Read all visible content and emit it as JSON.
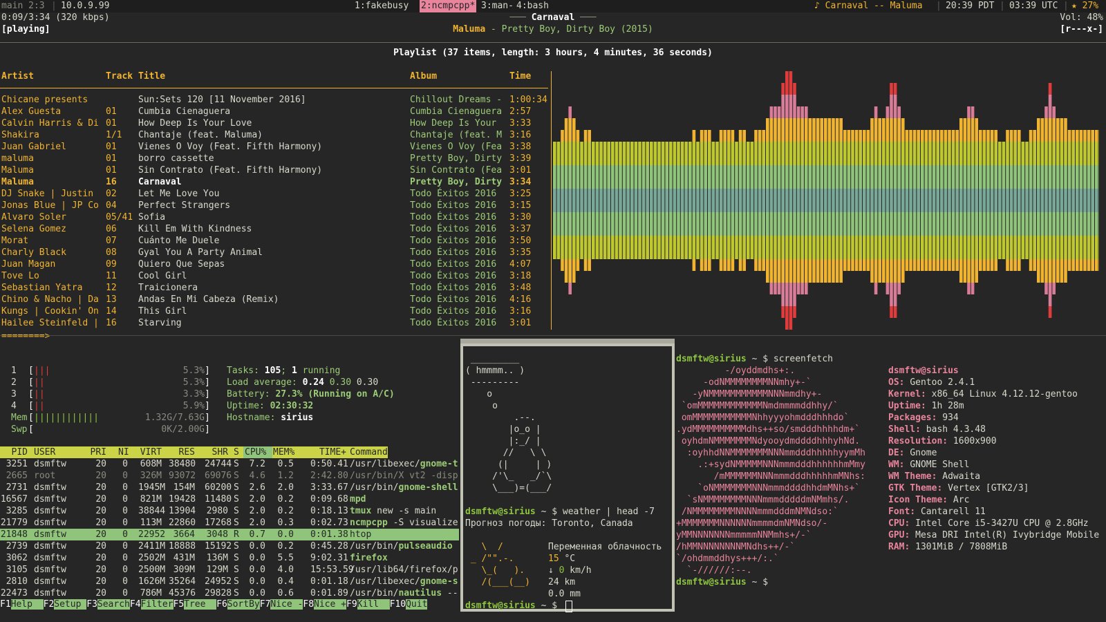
{
  "topbar": {
    "session": "main 2:3",
    "ip": "10.0.9.99",
    "workspaces": [
      "1:fakebusy",
      "2:ncmpcpp*",
      "3:man-",
      "4:bash"
    ],
    "now_playing": "♪ Carnaval -- Maluma",
    "local_time": "20:39 PDT",
    "utc_time": "03:39 UTC",
    "battery": "★ 27%"
  },
  "player": {
    "elapsed": "0:09/3:34 (320 kbps)",
    "state": "[playing]",
    "title": "Carnaval",
    "artist": "Maluma",
    "album_line": " - Pretty Boy, Dirty Boy (2015)",
    "volume": "Vol: 48%",
    "flags": "[r---x-]",
    "progress_bar": "========>",
    "progress": 0.04
  },
  "playlist": {
    "heading": "Playlist (37 items, length: 3 hours, 4 minutes, 36 seconds)",
    "columns": [
      "Artist",
      "Track",
      "Title",
      "Album",
      "Time"
    ],
    "rows": [
      [
        "Chicane presents",
        "",
        "Sun:Sets 120 [11 November 2016]",
        "Chillout Dreams -",
        "1:00:34"
      ],
      [
        "Alex Guesta",
        "01",
        "Cumbia Cienaguera",
        "Cumbia Cienaguera",
        "2:57"
      ],
      [
        "Calvin Harris & Di",
        "01",
        "How Deep Is Your Love",
        "How Deep Is Your",
        "3:33"
      ],
      [
        "Shakira",
        "1/1",
        "Chantaje (feat. Maluma)",
        "Chantaje (feat. M",
        "3:16"
      ],
      [
        "Juan Gabriel",
        "01",
        "Vienes O Voy (Feat. Fifth Harmony)",
        "Vienes O Voy (Fea",
        "3:38"
      ],
      [
        "maluma",
        "01",
        "borro cassette",
        "Pretty Boy, Dirty",
        "3:39"
      ],
      [
        "Maluma",
        "01",
        "Sin Contrato (Feat. Fifth Harmony)",
        "Sin Contrato (Fea",
        "3:01"
      ],
      [
        "Maluma",
        "16",
        "Carnaval",
        "Pretty Boy, Dirty",
        "3:34"
      ],
      [
        "DJ Snake | Justin",
        "02",
        "Let Me Love You",
        "Todo Éxitos 2016",
        "3:25"
      ],
      [
        "Jonas Blue | JP Co",
        "04",
        "Perfect Strangers",
        "Todo Éxitos 2016",
        "3:15"
      ],
      [
        "Alvaro Soler",
        "05/41",
        "Sofia",
        "Todo Éxitos 2016",
        "3:30"
      ],
      [
        "Selena Gomez",
        "06",
        "Kill Em With Kindness",
        "Todo Éxitos 2016",
        "3:37"
      ],
      [
        "Morat",
        "07",
        "Cuánto Me Duele",
        "Todo Éxitos 2016",
        "3:50"
      ],
      [
        "Charly Black",
        "08",
        "Gyal You A Party Animal",
        "Todo Éxitos 2016",
        "3:35"
      ],
      [
        "Juan Magan",
        "09",
        "Quiero Que Sepas",
        "Todo Éxitos 2016",
        "4:07"
      ],
      [
        "Tove Lo",
        "11",
        "Cool Girl",
        "Todo Éxitos 2016",
        "3:18"
      ],
      [
        "Sebastian Yatra",
        "12",
        "Traicionera",
        "Todo Éxitos 2016",
        "3:48"
      ],
      [
        "Chino & Nacho | Da",
        "13",
        "Andas En Mi Cabeza (Remix)",
        "Todo Éxitos 2016",
        "4:16"
      ],
      [
        "Kungs | Cookin' On",
        "14",
        "This Girl",
        "Todo Éxitos 2016",
        "3:16"
      ],
      [
        "Hailee Steinfeld |",
        "16",
        "Starving",
        "Todo Éxitos 2016",
        "3:01"
      ]
    ],
    "current_index": 7
  },
  "visualizer": {
    "colors": [
      "#e03c3c",
      "#d87c98",
      "#f0b430",
      "#c0c830",
      "#8fc47a",
      "#7aa898"
    ],
    "levels": [
      0.47,
      0.47,
      0.57,
      0.67,
      0.77,
      0.67,
      0.57,
      0.47,
      0.57,
      0.57,
      0.47,
      0.47,
      0.47,
      0.47,
      0.47,
      0.47,
      0.47,
      0.47,
      0.47,
      0.47,
      0.47,
      0.47,
      0.47,
      0.47,
      0.47,
      0.47,
      0.47,
      0.47,
      0.47,
      0.47,
      0.47,
      0.47,
      0.47,
      0.47,
      0.47,
      0.47,
      0.57,
      0.47,
      0.57,
      0.57,
      0.57,
      0.47,
      0.47,
      0.57,
      0.57,
      0.57,
      0.57,
      0.47,
      0.57,
      0.57,
      0.47,
      0.47,
      0.57,
      0.57,
      0.57,
      0.67,
      0.77,
      0.77,
      0.77,
      0.87,
      0.97,
      0.97,
      0.87,
      0.77,
      0.77,
      0.77,
      0.67,
      0.67,
      0.67,
      0.67,
      0.67,
      0.67,
      0.67,
      0.67,
      0.67,
      0.57,
      0.57,
      0.57,
      0.57,
      0.57,
      0.57,
      0.57,
      0.67,
      0.77,
      0.67,
      0.67,
      0.77,
      0.87,
      0.87,
      0.77,
      0.67,
      0.57,
      0.57,
      0.57,
      0.57,
      0.57,
      0.57,
      0.57,
      0.57,
      0.57,
      0.57,
      0.57,
      0.57,
      0.57,
      0.57,
      0.67,
      0.67,
      0.77,
      0.77,
      0.67,
      0.57,
      0.57,
      0.57,
      0.57,
      0.57,
      0.47,
      0.47,
      0.57,
      0.57,
      0.57,
      0.57,
      0.47,
      0.47,
      0.57,
      0.57,
      0.67,
      0.67,
      0.77,
      0.87,
      0.77,
      0.67,
      0.67,
      0.67,
      0.57,
      0.57,
      0.57,
      0.57,
      0.57,
      0.57,
      0.57,
      0.57,
      0.57,
      0.67,
      0.67,
      0.57,
      0.57,
      0.67
    ]
  },
  "htop": {
    "cpus": [
      {
        "id": "1",
        "bar": "|||",
        "pct": "5.3%"
      },
      {
        "id": "2",
        "bar": "||",
        "pct": "5.3%"
      },
      {
        "id": "3",
        "bar": "||",
        "pct": "3.3%"
      },
      {
        "id": "4",
        "bar": "||",
        "pct": "5.9%"
      }
    ],
    "mem": {
      "label": "Mem",
      "bar": "||||||||||||",
      "value": "1.32G/7.63G"
    },
    "swp": {
      "label": "Swp",
      "bar": "",
      "value": "0K/2.00G"
    },
    "tasks_label": "Tasks: ",
    "tasks": "105",
    "tasks_sep": "; ",
    "running": "1",
    "running_label": " running",
    "load_label": "Load average: ",
    "load1": "0.24",
    "load5": "0.30",
    "load15": "0.30",
    "battery_label": "Battery: ",
    "battery": "27.3% (Running on A/C)",
    "uptime_label": "Uptime: ",
    "uptime": "02:30:32",
    "hostname_label": "Hostname: ",
    "hostname": "sirius",
    "columns": [
      "PID",
      "USER",
      "PRI",
      "NI",
      "VIRT",
      "RES",
      "SHR",
      "S",
      "CPU%",
      "MEM%",
      "TIME+",
      "Command"
    ],
    "processes": [
      {
        "pid": "3251",
        "user": "dsmftw",
        "pri": "20",
        "ni": "0",
        "virt": "608M",
        "res": "38480",
        "shr": "24744",
        "s": "S",
        "cpu": "7.2",
        "mem": "0.5",
        "time": "0:50.41",
        "cmd_path": "/usr/libexec/",
        "cmd_name": "gnome-t",
        "cmd_args": ""
      },
      {
        "pid": "2665",
        "user": "root",
        "pri": "20",
        "ni": "0",
        "virt": "326M",
        "res": "93072",
        "shr": "69076",
        "s": "S",
        "cpu": "4.6",
        "mem": "1.2",
        "time": "2:42.80",
        "cmd_path": "/usr/bin/X vt2 -disp",
        "cmd_name": "",
        "cmd_args": ""
      },
      {
        "pid": "2731",
        "user": "dsmftw",
        "pri": "20",
        "ni": "0",
        "virt": "1945M",
        "res": "154M",
        "shr": "60200",
        "s": "S",
        "cpu": "2.6",
        "mem": "2.0",
        "time": "3:33.67",
        "cmd_path": "/usr/bin/",
        "cmd_name": "gnome-shell",
        "cmd_args": ""
      },
      {
        "pid": "16567",
        "user": "dsmftw",
        "pri": "20",
        "ni": "0",
        "virt": "821M",
        "res": "19428",
        "shr": "11480",
        "s": "S",
        "cpu": "2.0",
        "mem": "0.2",
        "time": "0:09.68",
        "cmd_path": "",
        "cmd_name": "mpd",
        "cmd_args": ""
      },
      {
        "pid": "3285",
        "user": "dsmftw",
        "pri": "20",
        "ni": "0",
        "virt": "38844",
        "res": "13904",
        "shr": "2980",
        "s": "S",
        "cpu": "2.0",
        "mem": "0.2",
        "time": "0:18.13",
        "cmd_path": "",
        "cmd_name": "tmux",
        "cmd_args": " new -s main"
      },
      {
        "pid": "21779",
        "user": "dsmftw",
        "pri": "20",
        "ni": "0",
        "virt": "113M",
        "res": "22860",
        "shr": "17268",
        "s": "S",
        "cpu": "2.0",
        "mem": "0.3",
        "time": "0:02.73",
        "cmd_path": "",
        "cmd_name": "ncmpcpp",
        "cmd_args": " -S visualize"
      },
      {
        "pid": "21848",
        "user": "dsmftw",
        "pri": "20",
        "ni": "0",
        "virt": "22952",
        "res": "3664",
        "shr": "3048",
        "s": "R",
        "cpu": "0.7",
        "mem": "0.0",
        "time": "0:01.38",
        "cmd_path": "",
        "cmd_name": "htop",
        "cmd_args": ""
      },
      {
        "pid": "2739",
        "user": "dsmftw",
        "pri": "20",
        "ni": "0",
        "virt": "2411M",
        "res": "18888",
        "shr": "15192",
        "s": "S",
        "cpu": "0.0",
        "mem": "0.2",
        "time": "0:45.28",
        "cmd_path": "/usr/bin/",
        "cmd_name": "pulseaudio",
        "cmd_args": ""
      },
      {
        "pid": "3062",
        "user": "dsmftw",
        "pri": "20",
        "ni": "0",
        "virt": "2502M",
        "res": "431M",
        "shr": "136M",
        "s": "S",
        "cpu": "0.0",
        "mem": "5.5",
        "time": "9:02.31",
        "cmd_path": "",
        "cmd_name": "firefox",
        "cmd_args": ""
      },
      {
        "pid": "3105",
        "user": "dsmftw",
        "pri": "20",
        "ni": "0",
        "virt": "2500M",
        "res": "309M",
        "shr": "129M",
        "s": "S",
        "cpu": "0.0",
        "mem": "4.0",
        "time": "15:53.59",
        "cmd_path": "/usr/lib64/firefox/p",
        "cmd_name": "",
        "cmd_args": ""
      },
      {
        "pid": "2810",
        "user": "dsmftw",
        "pri": "20",
        "ni": "0",
        "virt": "1626M",
        "res": "35264",
        "shr": "24952",
        "s": "S",
        "cpu": "0.0",
        "mem": "0.4",
        "time": "0:01.18",
        "cmd_path": "/usr/libexec/",
        "cmd_name": "gnome-s",
        "cmd_args": ""
      },
      {
        "pid": "22473",
        "user": "dsmftw",
        "pri": "20",
        "ni": "0",
        "virt": "786M",
        "res": "45376",
        "shr": "29828",
        "s": "S",
        "cpu": "0.0",
        "mem": "0.6",
        "time": "0:01.89",
        "cmd_path": "/usr/bin/",
        "cmd_name": "nautilus",
        "cmd_args": " --"
      }
    ],
    "selected_index": 6,
    "fkeys": [
      [
        "F1",
        "Help  "
      ],
      [
        "F2",
        "Setup "
      ],
      [
        "F3",
        "Search"
      ],
      [
        "F4",
        "Filter"
      ],
      [
        "F5",
        "Tree  "
      ],
      [
        "F6",
        "SortBy"
      ],
      [
        "F7",
        "Nice -"
      ],
      [
        "F8",
        "Nice +"
      ],
      [
        "F9",
        "Kill  "
      ],
      [
        "F10",
        "Quit"
      ]
    ]
  },
  "cowsay": {
    "art": " _________\n( hmmmm.. )\n ---------\n    o\n     o\n         .--.\n        |o_o |\n        |:_/ |\n       //   \\ \\\n      (|     | )\n     /'\\_   _/`\\\n     \\___)=(___/",
    "prompt_user": "dsmftw@sirius",
    "prompt_rest": " ~ $ ",
    "command": "weather | head -7",
    "forecast_title": "Прогноз погоды: Toronto, Canada",
    "weather_icon": "   \\  /\n _ /\"\".-.\n   \\_(   ).\n   /(___(__)",
    "condition": "Переменная облачность",
    "temp": "15",
    "temp_unit": " °C",
    "wind_dir": "↓ ",
    "wind": "0",
    "wind_unit": " km/h",
    "visibility": "24 km",
    "precip": "0.0 mm"
  },
  "screenfetch": {
    "prompt_user": "dsmftw@sirius",
    "prompt_rest": " ~ $ ",
    "command": "screenfetch",
    "logo": [
      "         -/oyddmdhs+:.",
      "     -odNMMMMMMMMNNmhy+-`",
      "   -yNMMMMMMMMMMMNNNmmdhy+-",
      " `omMMMMMMMMMMMMNmdmmmmddhhy/`",
      " omMMMMMMMMMMMNhhyyyohmdddhhhdo`",
      ".ydMMMMMMMMMMdhs++so/smdddhhhhdm+`",
      " oyhdmNMMMMMMMNdyooydmddddhhhyhNd.",
      "  :oyhhdNNMMMMMMMNNNmmdddhhhhhyymMh",
      "    .:+sydNMMMMMNNNmmmdddhhhhhhmMmy",
      "       /mMMMMMMNNNmmmdddhhhhhmMNhs:",
      "    `oNMMMMMMMNNNmmmddddhhdmMNhs+`",
      "  `sNMMMMMMMMNNNmmmdddddmNMmhs/.",
      " /NMMMMMMMMNNNNmmmdddmNMNdso:`",
      "+MMMMMMMNNNNNNmmmmdmNMNdso/-",
      "yMMNNNNNNNmmmmmNNMmhs+/-`",
      "/hMMNNNNNNNNMNdhs++/-`",
      "`/ohdmmddhys+++/:.`",
      "  `-//////:--."
    ],
    "info": [
      {
        "key": "",
        "value": "dsmftw@sirius"
      },
      {
        "key": "OS: ",
        "value": "Gentoo 2.4.1"
      },
      {
        "key": "Kernel: ",
        "value": "x86_64 Linux 4.12.12-gentoo"
      },
      {
        "key": "Uptime: ",
        "value": "1h 28m"
      },
      {
        "key": "Packages: ",
        "value": "934"
      },
      {
        "key": "Shell: ",
        "value": "bash 4.3.48"
      },
      {
        "key": "Resolution: ",
        "value": "1600x900"
      },
      {
        "key": "DE: ",
        "value": "Gnome"
      },
      {
        "key": "WM: ",
        "value": "GNOME Shell"
      },
      {
        "key": "WM Theme: ",
        "value": "Adwaita"
      },
      {
        "key": "GTK Theme: ",
        "value": "Vertex [GTK2/3]"
      },
      {
        "key": "Icon Theme: ",
        "value": "Arc"
      },
      {
        "key": "Font: ",
        "value": "Cantarell 11"
      },
      {
        "key": "CPU: ",
        "value": "Intel Core i5-3427U CPU @ 2.8GHz"
      },
      {
        "key": "GPU: ",
        "value": "Mesa DRI Intel(R) Ivybridge Mobile"
      },
      {
        "key": "RAM: ",
        "value": "1301MiB / 7808MiB"
      }
    ]
  }
}
